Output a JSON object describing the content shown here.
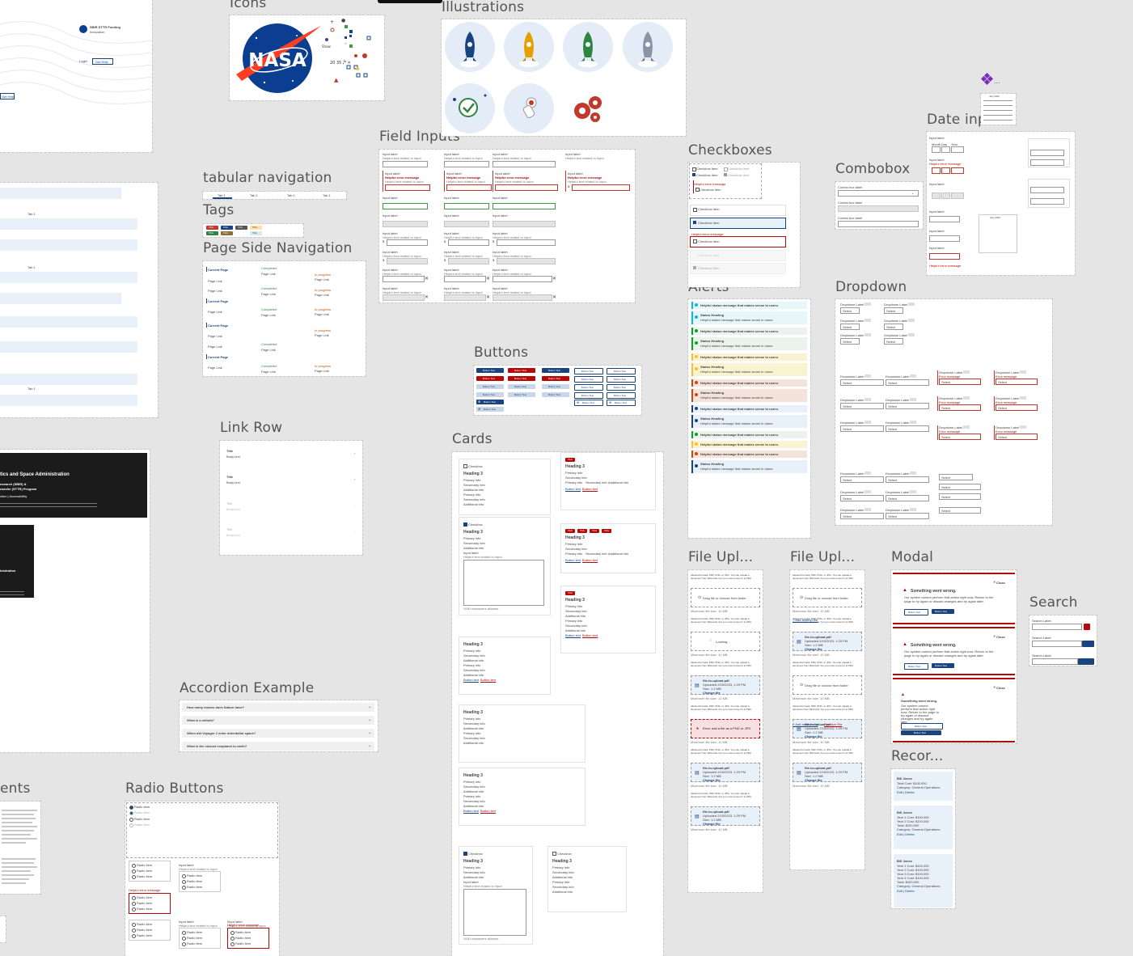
{
  "frames": {
    "icons": "Icons",
    "illustrations": "Illustrations",
    "field_inputs": "Field Inputs",
    "tabular_navigation": "tabular navigation",
    "tags": "Tags",
    "page_side_navigation": "Page Side Navigation",
    "checkboxes": "Checkboxes",
    "combobox": "Combobox",
    "date_inputs": "Date inputs",
    "alerts": "Alerts",
    "dropdown": "Dropdown",
    "buttons": "Buttons",
    "link_row": "Link Row",
    "cards": "Cards",
    "accordion_example": "Accordion Example",
    "file_upload_1": "File Upl...",
    "file_upload_2": "File Upl...",
    "modal": "Modal",
    "search": "Search",
    "records": "Recor...",
    "radio_buttons": "Radio Buttons",
    "elements_partial": "ents"
  },
  "top_left": {
    "brand": "SBIR STTR Funding",
    "brand_sub": "Innovation",
    "login": "Login",
    "get_help": "Get Help",
    "help": "Get Help"
  },
  "nasa_logo_text": "NASA",
  "tabs": [
    "Tab 1",
    "Tab 1",
    "Tab 1",
    "Tab 1"
  ],
  "left_tabs": [
    "Tab 1",
    "Tab 1",
    "Tab 1",
    "Tab 1"
  ],
  "tags": [
    "TAG",
    "TAG",
    "TAG",
    "TAG",
    "TAG",
    "TAG",
    "TAG"
  ],
  "side_nav": {
    "items": [
      "Current Page",
      "Page Link",
      "Page Link",
      "Current Page",
      "Page Link",
      "Current Page",
      "Page Link",
      "Page Link",
      "Current Page",
      "Page Link"
    ],
    "status": [
      "Completed",
      "Page Link",
      "Completed",
      "Page Link",
      "Completed",
      "Page Link",
      "Completed",
      "Page Link",
      "Completed",
      "Page Link"
    ],
    "progress": [
      "In progress",
      "Page Link",
      "In progress",
      "Page Link",
      "In progress",
      "Page Link",
      "In progress",
      "Page Link",
      "In progress",
      "Page Link"
    ]
  },
  "field": {
    "label": "Input label",
    "hint": "Helpful text related to input",
    "error": "Helpful error message"
  },
  "checkbox": {
    "item": "Checkbox item",
    "error": "Helpful error message"
  },
  "combobox": {
    "label": "Combo box label"
  },
  "date": {
    "label": "Input label",
    "month": "Month",
    "day": "Day",
    "year": "Year",
    "error": "Helpful error message",
    "calendar_month": "July 2024"
  },
  "alert": {
    "message": "Helpful status message that makes sense to users.",
    "heading": "Status Heading"
  },
  "dropdown": {
    "label": "Dropdown Label",
    "select": "Select",
    "error": "Error message"
  },
  "buttons": {
    "label": "Button Text"
  },
  "link_row": {
    "title": "Title",
    "body": "Body text"
  },
  "cards": {
    "checkbox": "Checkbox",
    "tag": "TAG",
    "heading": "Heading 3",
    "primary": "Primary info",
    "secondary": "Secondary info",
    "additional": "Additional info",
    "button": "Button text",
    "input_label": "Input label",
    "hint": "Helpful text related to input",
    "counter": "1000 characters allowed"
  },
  "accordion": {
    "items": [
      "How many moons does Saturn have?",
      "What is a nebula?",
      "When did Voyager 1 enter interstellar space?",
      "What is the closest exoplanet to earth?"
    ]
  },
  "file_upload": {
    "formats": "Allowed formats: PDF, PNG, or JPG. You can upload a document from Microsoft, but you must convert it to PDF.",
    "drag": "Drag file or choose from folder",
    "max": "Maximum file size: 10 MB",
    "loading": "Loading...",
    "file_name": "file-to-upload.pdf",
    "uploaded": "Uploaded 2/15/2023, 1:29 PM",
    "size": "Size: 1.2 MB",
    "change": "Change file",
    "error": "Error: add a file as a PNG or JPG",
    "add_another": "+ Add another file",
    "remove": "Remove File"
  },
  "modal": {
    "close": "Close",
    "heading": "Something went wrong.",
    "body": "Our system cannot perform that action right now. Return to the page to try again or discard changes and try again later.",
    "secondary": "Button Text",
    "primary": "Button Text"
  },
  "search": {
    "label": "Search Label"
  },
  "records": [
    {
      "name": "Bill Jones",
      "lines": [
        "Total Cost: $100,000",
        "Category: General Operations"
      ],
      "link": "Edit | Delete"
    },
    {
      "name": "Bill Jones",
      "lines": [
        "Year 1 Cost: $100,000",
        "Year 2 Cost: $100,000",
        "Total: $200,000",
        "Category: General Operations"
      ],
      "link": "Edit | Delete"
    },
    {
      "name": "Bill Jones",
      "lines": [
        "Year 1 Cost: $100,000",
        "Year 2 Cost: $100,000",
        "Year 3 Cost: $100,000",
        "Year 4 Cost: $100,000",
        "Total: $400,000",
        "Category: General Operations"
      ],
      "link": "Edit | Delete"
    }
  ],
  "radio": {
    "item": "Radio item",
    "label": "Input label",
    "hint": "Helpful text related to input",
    "error": "Helpful error message"
  },
  "dark_panel": {
    "title": "tics and Space Administration",
    "sub1": "esearch (SBIR) &",
    "sub2": "ransfer (STTR) Program",
    "links": "ction | Accessibility",
    "lower": "inistration"
  },
  "colors": {
    "uswds_blue": "#1a4480",
    "error_red": "#b50909",
    "success_green": "#00a91c",
    "warning_yellow": "#ffbe2e",
    "info_cyan": "#00bde3",
    "canvas_gray": "#e5e5e5"
  }
}
